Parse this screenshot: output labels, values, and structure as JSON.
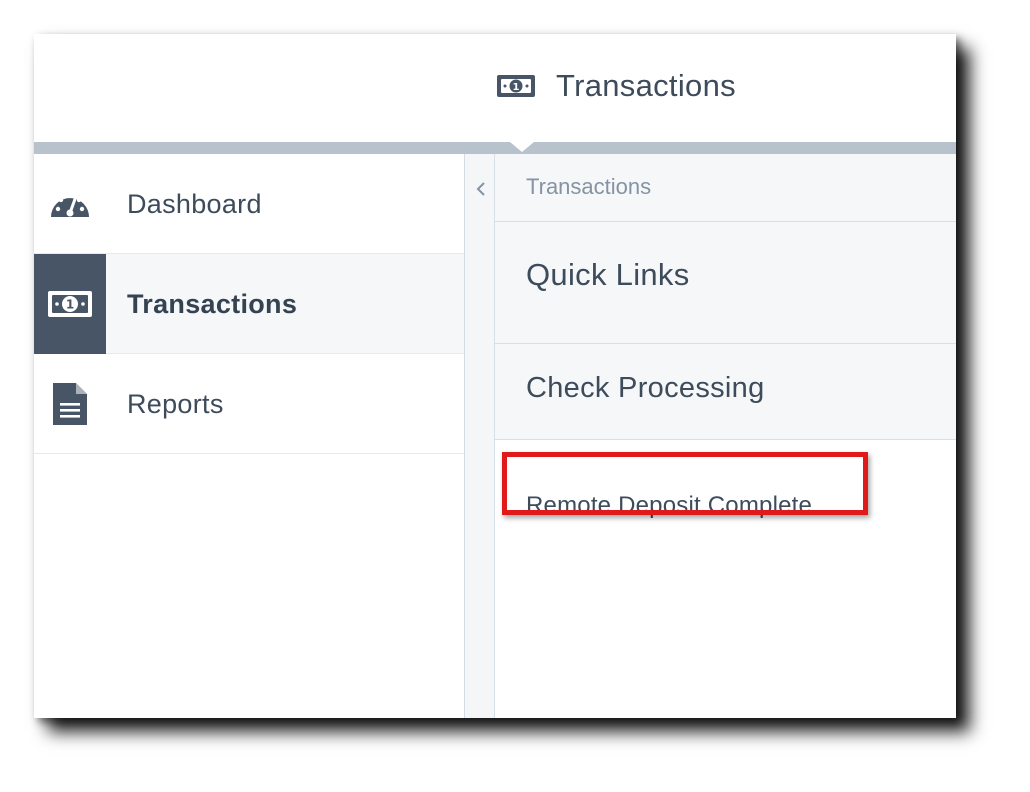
{
  "header": {
    "title": "Transactions",
    "icon": "money-bill-icon"
  },
  "sidebar": {
    "items": [
      {
        "label": "Dashboard",
        "icon": "dashboard-gauge-icon",
        "active": false
      },
      {
        "label": "Transactions",
        "icon": "money-bill-icon",
        "active": true
      },
      {
        "label": "Reports",
        "icon": "document-icon",
        "active": false
      }
    ]
  },
  "content": {
    "breadcrumb": "Transactions",
    "collapse_icon": "chevron-left-icon",
    "items": [
      {
        "label": "Quick Links"
      },
      {
        "label": "Check Processing"
      },
      {
        "label": "Remote Deposit Complete",
        "highlighted": true
      }
    ]
  },
  "colors": {
    "text": "#3d4b5b",
    "active_icon_bg": "#475566",
    "divider": "#b7c2cc",
    "highlight": "#e0191a"
  }
}
